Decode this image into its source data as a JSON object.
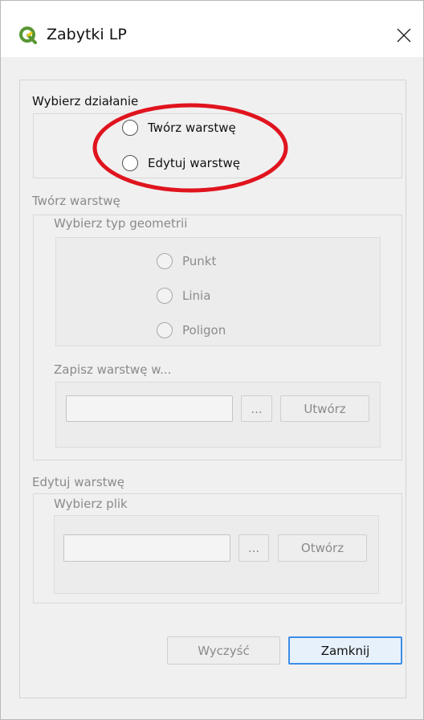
{
  "window": {
    "title": "Zabytki LP"
  },
  "action_group": {
    "label": "Wybierz działanie",
    "options": [
      {
        "label": "Twórz warstwę",
        "selected": false
      },
      {
        "label": "Edytuj warstwę",
        "selected": false
      }
    ]
  },
  "create_group": {
    "label": "Twórz warstwę",
    "geometry_group": {
      "label": "Wybierz typ geometrii",
      "options": [
        {
          "label": "Punkt",
          "selected": false
        },
        {
          "label": "Linia",
          "selected": false
        },
        {
          "label": "Poligon",
          "selected": false
        }
      ]
    },
    "save_group": {
      "label": "Zapisz warstwę w...",
      "path_value": "",
      "browse_label": "...",
      "create_label": "Utwórz"
    }
  },
  "edit_group": {
    "label": "Edytuj warstwę",
    "file_group": {
      "label": "Wybierz plik",
      "path_value": "",
      "browse_label": "...",
      "open_label": "Otwórz"
    }
  },
  "footer": {
    "clear_label": "Wyczyść",
    "close_label": "Zamknij"
  },
  "colors": {
    "accent": "#3c8ce6",
    "annotation": "#e0141e",
    "qgis_green": "#589632",
    "qgis_yellow": "#f0c814"
  }
}
